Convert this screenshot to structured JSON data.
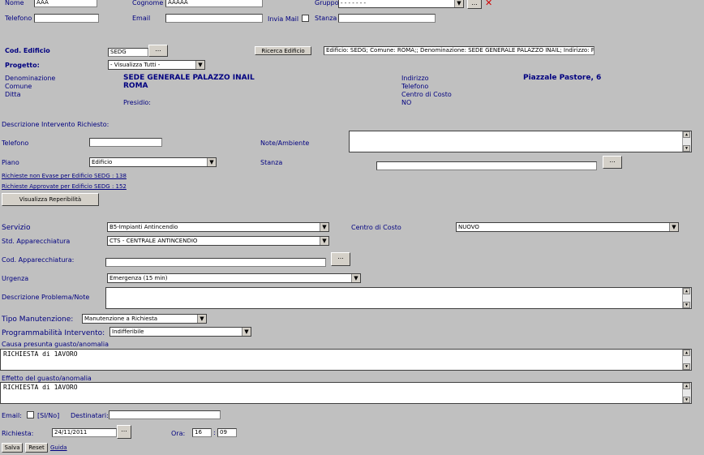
{
  "top": {
    "nome_label": "Nome",
    "nome_value": "AAA",
    "cognome_label": "Cognome",
    "cognome_value": "AAAAA",
    "gruppo_label": "Gruppo",
    "gruppo_value": "- - - - - - -",
    "telefono_label": "Telefono",
    "email_label": "Email",
    "invia_mail_label": "Invia Mail",
    "stanza_label": "Stanza"
  },
  "edificio": {
    "cod_label": "Cod. Edificio",
    "cod_value": "SEDG",
    "dots": "...",
    "ricerca_button": "Ricerca Edificio",
    "info_text": "Edificio: SEDG; Comune: ROMA;; Denominazione: SEDE GENERALE PALAZZO INAIL; Indirizzo: P",
    "progetto_label": "Progetto:",
    "progetto_value": "- Visualizza Tutti -",
    "denominazione_label": "Denominazione",
    "denominazione_value": "SEDE GENERALE PALAZZO INAIL",
    "comune_label": "Comune",
    "comune_value": "ROMA",
    "ditta_label": "Ditta",
    "presidio_label": "Presidio:",
    "indirizzo_label": "Indirizzo",
    "indirizzo_value": "Piazzale Pastore, 6",
    "telefono_label": "Telefono",
    "centro_costo_label": "Centro di Costo",
    "centro_costo_value": "NO"
  },
  "richiesta": {
    "descrizione_label": "Descrizione Intervento Richiesto:",
    "telefono_label": "Telefono",
    "note_label": "Note/Ambiente",
    "piano_label": "Piano",
    "piano_value": "Edificio",
    "stanza_label": "Stanza",
    "dots": "...",
    "link_non_evase": "Richieste non Evase per Edificio SEDG : 138",
    "link_approvate": "Richieste Approvate per Edificio SEDG : 152",
    "reperibilita_button": "Visualizza Reperibilità"
  },
  "servizio": {
    "servizio_label": "Servizio",
    "servizio_value": "B5-Impianti Antincendio",
    "centro_costo_label": "Centro di Costo",
    "centro_costo_value": "NUOVO",
    "std_label": "Std. Apparecchiatura",
    "std_value": "CTS - CENTRALE ANTINCENDIO",
    "cod_app_label": "Cod. Apparecchiatura:",
    "dots": "...",
    "urgenza_label": "Urgenza",
    "urgenza_value": "Emergenza (15 min)",
    "descr_label": "Descrizione Problema/Note",
    "tipo_label": "Tipo Manutenzione:",
    "tipo_value": "Manutenzione a Richiesta",
    "prog_label": "Programmabilità Intervento:",
    "prog_value": "Indifferibile",
    "causa_label": "Causa presunta guasto/anomalia",
    "causa_value": "RICHIESTA di 1AVORO",
    "effetto_label": "Effetto del guasto/anomalia",
    "effetto_value": "RICHIESTA di 1AVORO"
  },
  "footer": {
    "email_label": "Email:",
    "sino_label": "[SI/No]",
    "destinatari_label": "Destinatari:",
    "richiesta_label": "Richiesta:",
    "data_value": "24/11/2011",
    "dots": "...",
    "ora_label": "Ora:",
    "ora_h": "16",
    "colon": ":",
    "ora_m": "09",
    "salva": "Salva",
    "reset": "Reset",
    "guida": "Guida"
  },
  "icons": {
    "dropdown": "▼",
    "up": "▲",
    "down": "▼",
    "close": "✕"
  }
}
